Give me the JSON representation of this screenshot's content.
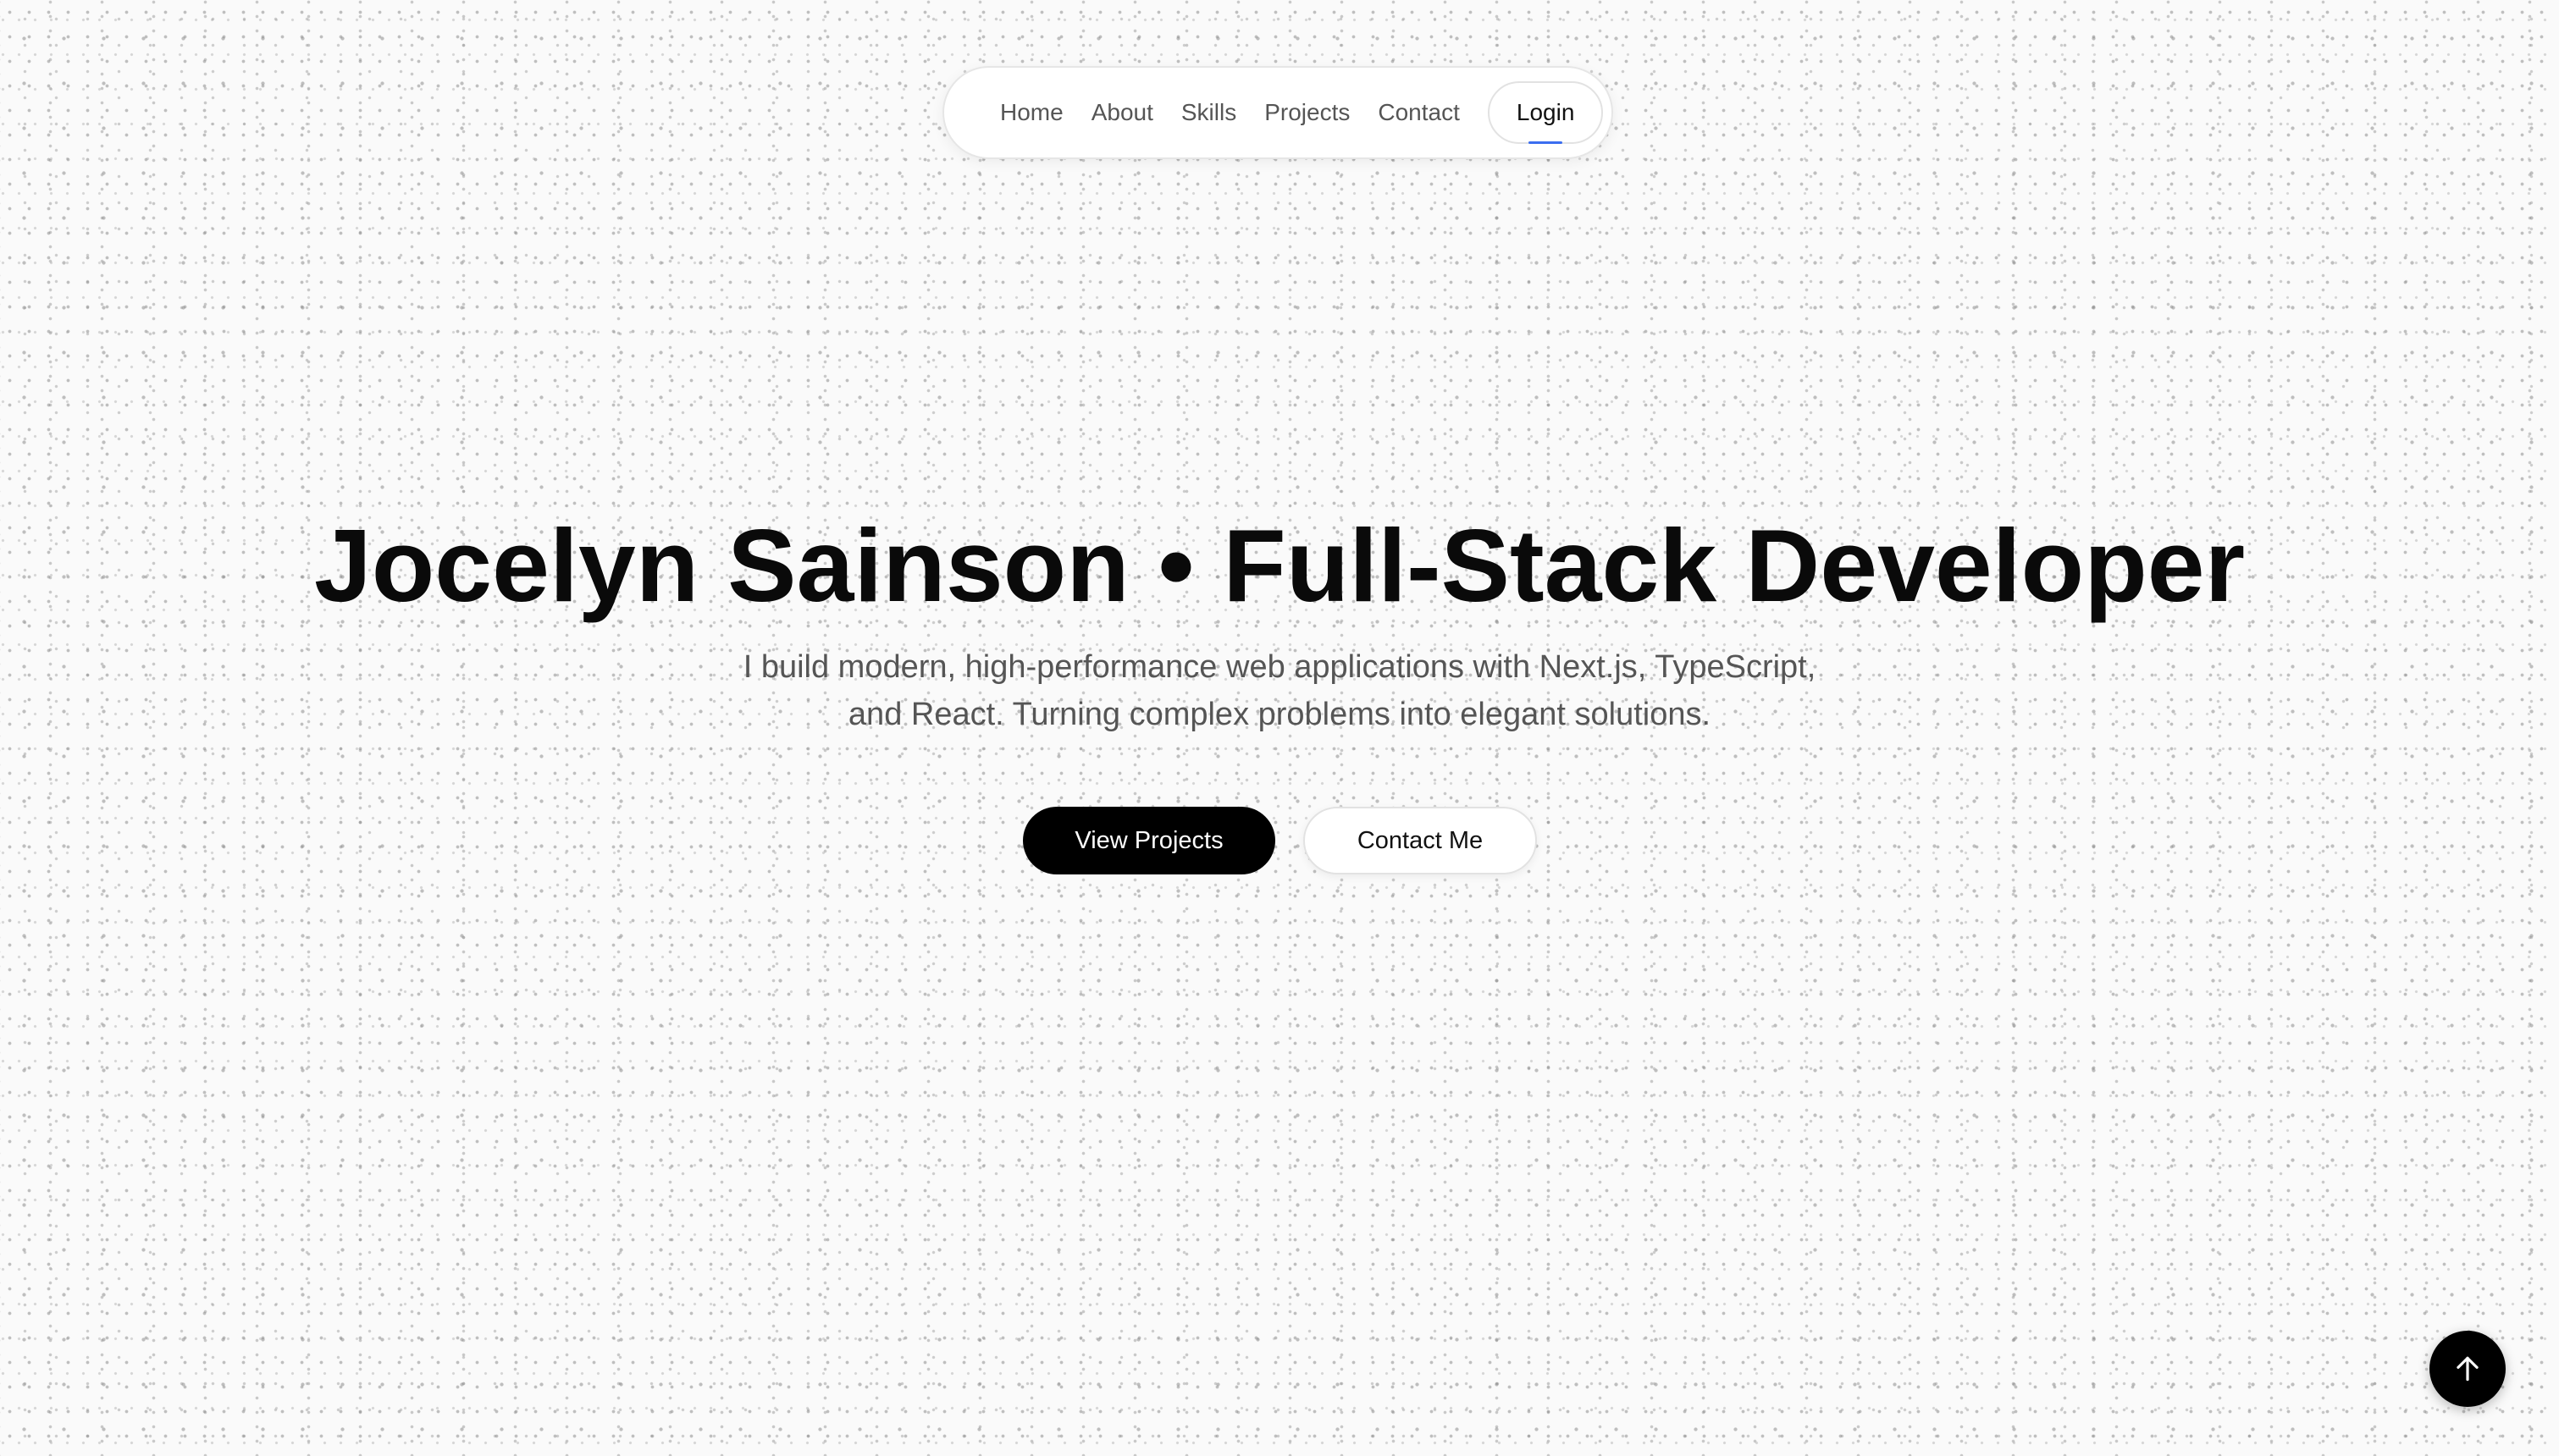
{
  "nav": {
    "items": [
      {
        "label": "Home"
      },
      {
        "label": "About"
      },
      {
        "label": "Skills"
      },
      {
        "label": "Projects"
      },
      {
        "label": "Contact"
      }
    ],
    "login_label": "Login"
  },
  "hero": {
    "title": "Jocelyn Sainson • Full-Stack Developer",
    "subtitle_line1": "I build modern, high-performance web applications with Next.js, TypeScript,",
    "subtitle_line2": "and React. Turning complex problems into elegant solutions.",
    "primary_cta": "View Projects",
    "secondary_cta": "Contact Me"
  },
  "icons": {
    "scroll_top": "arrow-up-icon"
  },
  "colors": {
    "background": "#fafafa",
    "text": "#0a0a0a",
    "muted": "#555555",
    "primary_button": "#000000",
    "accent": "#3b6ef0"
  }
}
